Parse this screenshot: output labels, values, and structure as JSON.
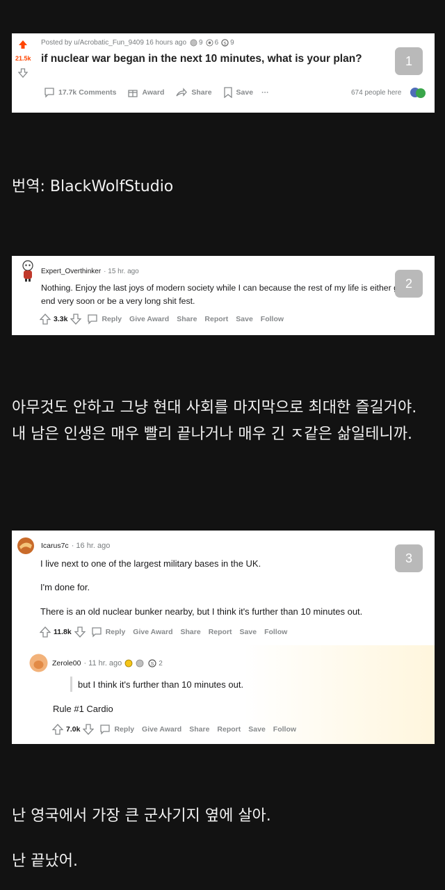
{
  "post": {
    "meta": "Posted by u/Acrobatic_Fun_9409 16 hours ago",
    "award_count_1": "9",
    "award_count_2": "6",
    "award_count_3": "9",
    "score": "21.5k",
    "title": "if nuclear war began in the next 10 minutes, what is your plan?",
    "comments_label": "17.7k Comments",
    "award_label": "Award",
    "share_label": "Share",
    "save_label": "Save",
    "more_label": "···",
    "people_here": "674 people here",
    "badge": "1"
  },
  "translator": "번역: BlackWolfStudio",
  "comment1": {
    "user": "Expert_Overthinker",
    "time": "· 15 hr. ago",
    "text": "Nothing. Enjoy the last joys of modern society while I can because the rest of my life is either gonna end very soon or be a very long shit fest.",
    "score": "3.3k",
    "reply": "Reply",
    "give_award": "Give Award",
    "share": "Share",
    "report": "Report",
    "save": "Save",
    "follow": "Follow",
    "badge": "2"
  },
  "translation1": "아무것도 안하고 그냥 현대 사회를 마지막으로 최대한 즐길거야. 내 남은 인생은 매우 빨리 끝나거나 매우 긴 ㅈ같은 삶일테니까.",
  "comment2": {
    "user": "Icarus7c",
    "time": "· 16 hr. ago",
    "line1": "I live next to one of the largest military bases in the UK.",
    "line2": "I'm done for.",
    "line3": "There is an old nuclear bunker nearby, but I think it's further than 10 minutes out.",
    "score": "11.8k",
    "reply": "Reply",
    "give_award": "Give Award",
    "share": "Share",
    "report": "Report",
    "save": "Save",
    "follow": "Follow",
    "badge": "3"
  },
  "reply": {
    "user": "Zerole00",
    "time": "· 11 hr. ago",
    "award_count": "2",
    "quote": "but I think it's further than 10 minutes out.",
    "text": "Rule #1 Cardio",
    "score": "7.0k",
    "reply": "Reply",
    "give_award": "Give Award",
    "share": "Share",
    "report": "Report",
    "save": "Save",
    "follow": "Follow"
  },
  "translation2_line1": "난 영국에서 가장 큰 군사기지 옆에 살아.",
  "translation2_line2": "난 끝났어.",
  "colors": {
    "upvote": "#ff4500",
    "badge": "#b9b9b9",
    "background": "#121212"
  }
}
